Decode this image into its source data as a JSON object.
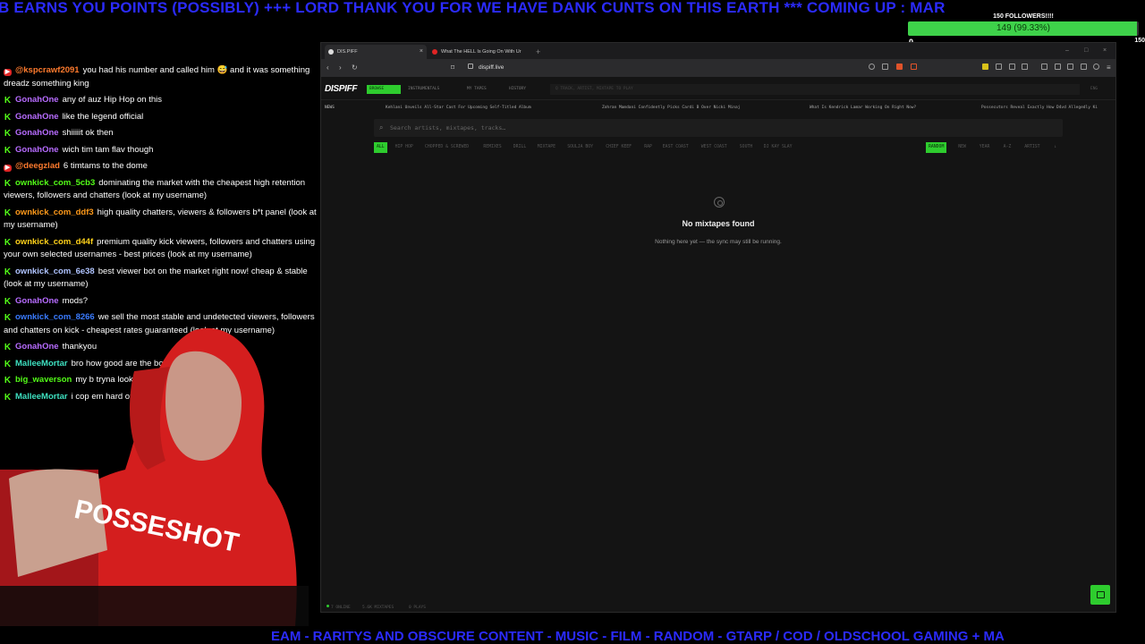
{
  "ticker_top": "B EARNS YOU POINTS (POSSIBLY) +++ LORD THANK YOU FOR WE HAVE DANK CUNTS ON THIS EARTH *** COMING UP : MAR",
  "ticker_bottom": "EAM  - RARITYS AND OBSCURE CONTENT - MUSIC - FILM - RANDOM - GTARP / COD / OLDSCHOOL GAMING + MA",
  "goal": {
    "title": "150 FOLLOWERS!!!!",
    "progress_text": "149 (99.33%)",
    "progress_fraction": 0.9933,
    "min": "0",
    "max": "150"
  },
  "chat": [
    {
      "platform": "yt",
      "user": "@kspcrawf2091",
      "color": "#ff7b2e",
      "text": "you had his number and called him 😅 and it was something dreadz something king"
    },
    {
      "platform": "kick",
      "user": "GonahOne",
      "color": "#b76cff",
      "text": "any of auz Hip Hop on this"
    },
    {
      "platform": "kick",
      "user": "GonahOne",
      "color": "#b76cff",
      "text": "like the legend official"
    },
    {
      "platform": "kick",
      "user": "GonahOne",
      "color": "#b76cff",
      "text": "shiiiiit ok then"
    },
    {
      "platform": "kick",
      "user": "GonahOne",
      "color": "#b76cff",
      "text": "wich tim tam flav though"
    },
    {
      "platform": "yt",
      "user": "@deegzlad",
      "color": "#ff7b2e",
      "text": "6 timtams to the dome"
    },
    {
      "platform": "kick",
      "user": "ownkick_com_5cb3",
      "color": "#53fc18",
      "text": "dominating the market with the cheapest high retention viewers, followers and chatters (look at my username)"
    },
    {
      "platform": "kick",
      "user": "ownkick_com_ddf3",
      "color": "#ff9a1a",
      "text": "high quality chatters, viewers & followers b*t panel (look at my username)"
    },
    {
      "platform": "kick",
      "user": "ownkick_com_d44f",
      "color": "#ffd21a",
      "text": "premium quality kick viewers, followers and chatters using your own selected usernames - best prices (look at my username)"
    },
    {
      "platform": "kick",
      "user": "ownkick_com_6e38",
      "color": "#b0c4ff",
      "text": "best viewer bot on the market right now! cheap & stable (look at my username)"
    },
    {
      "platform": "kick",
      "user": "GonahOne",
      "color": "#b76cff",
      "text": "mods?"
    },
    {
      "platform": "kick",
      "user": "ownkick_com_8266",
      "color": "#3a7bff",
      "text": "we sell the most stable and undetected viewers, followers and chatters on kick - cheapest rates guaranteed (look at my username)"
    },
    {
      "platform": "kick",
      "user": "GonahOne",
      "color": "#b76cff",
      "text": "thankyou"
    },
    {
      "platform": "kick",
      "user": "MalleeMortar",
      "color": "#3ee0c0",
      "text": "bro how good are the bots"
    },
    {
      "platform": "kick",
      "user": "big_waverson",
      "color": "#53fc18",
      "text": "my b tryna look at some mixtapes on here"
    },
    {
      "platform": "kick",
      "user": "MalleeMortar",
      "color": "#3ee0c0",
      "text": "i cop em hard on twitch"
    }
  ],
  "browser": {
    "tab1": "DIS.PIFF",
    "tab2": "What The HELL Is Going On With Ur",
    "url": "dispiff.live",
    "site": {
      "logo": "DISPIFF",
      "nav": [
        "BROWSE",
        "INSTRUMENTALS",
        "MY TAPES",
        "HISTORY"
      ],
      "search_placeholder": "Q  TRACK, ARTIST, MIXTAPE TO PLAY",
      "nav_right": "ENG",
      "news_label": "NEWS",
      "news": [
        "Kehlani Unveils All-Star Cast For Upcoming Self-Titled Album",
        "Zohran Mamdani Confidently Picks Cardi B Over Nicki Minaj",
        "What Is Kendrick Lamar Working On Right Now?",
        "Possecutors Reveal Exactly How D4vd Allegedly Ki"
      ],
      "main_search_placeholder": "Search artists, mixtapes, tracks…",
      "genres": [
        "ALL",
        "HIP HOP",
        "CHOPPED & SCREWED",
        "REMIXES",
        "DRILL",
        "MIXTAPE",
        "SOULJA BOY",
        "CHIEF KEEF",
        "RAP",
        "EAST COAST",
        "WEST COAST",
        "SOUTH",
        "DJ KAY SLAY"
      ],
      "sorts": [
        "RANDOM",
        "NEW",
        "YEAR",
        "A-Z",
        "ARTIST",
        "↓"
      ],
      "empty_title": "No mixtapes found",
      "empty_sub": "Nothing here yet — the sync may still be running.",
      "status": {
        "online": "7 ONLINE",
        "mixtapes": "5.6K MIXTAPES",
        "plays": "0 PLAYS"
      }
    }
  }
}
